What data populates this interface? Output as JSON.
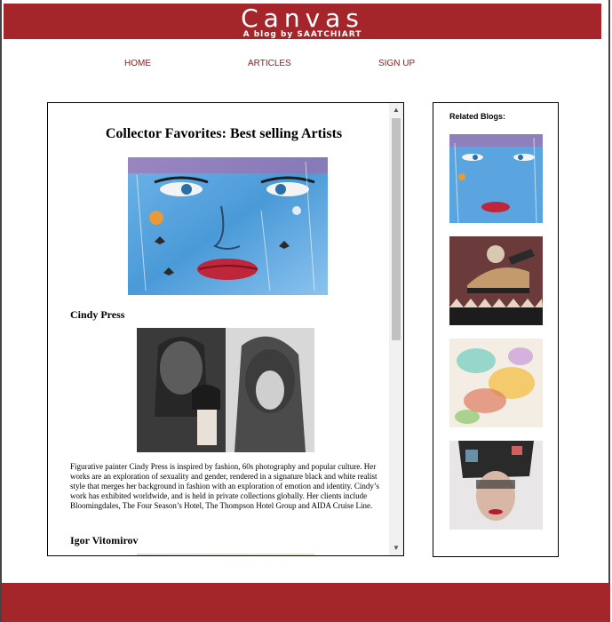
{
  "header": {
    "logo_title": "Canvas",
    "logo_subtitle": "A blog by SAATCHIART"
  },
  "nav": {
    "items": [
      {
        "label": "HOME"
      },
      {
        "label": "ARTICLES"
      },
      {
        "label": "SIGN UP"
      }
    ]
  },
  "article": {
    "title": "Collector Favorites: Best selling Artists",
    "hero_image_icon": "painted-face-artwork",
    "sections": [
      {
        "artist": "Cindy Press",
        "image_icon": "black-white-portrait-photos",
        "bio": "Figurative painter Cindy Press is inspired by fashion, 60s photography and popular culture. Her works are an exploration of sexuality and gender, rendered in a signature black and white realist style that merges her background in fashion with an exploration of emotion and identity. Cindy’s work has exhibited worldwide, and is held in private collections globally. Her clients include Bloomingdales, The Four Season’s Hotel, The Thompson Hotel Group and AIDA Cruise Line."
      },
      {
        "artist": "Igor Vitomirov"
      }
    ]
  },
  "sidebar": {
    "heading": "Related Blogs:",
    "thumbnails": [
      {
        "icon": "painted-face-thumbnail"
      },
      {
        "icon": "abstract-figure-thumbnail"
      },
      {
        "icon": "watercolor-splash-thumbnail"
      },
      {
        "icon": "fragmented-portrait-thumbnail"
      }
    ]
  },
  "colors": {
    "brand_red": "#a4262a",
    "nav_link": "#8b1a1a"
  }
}
